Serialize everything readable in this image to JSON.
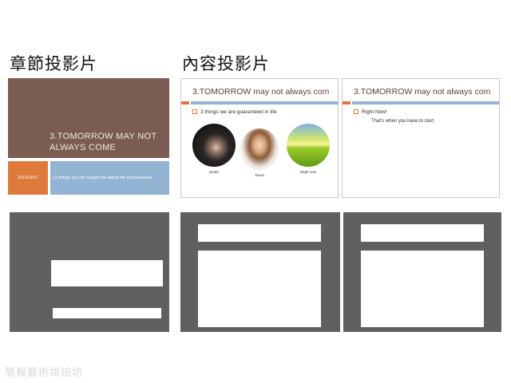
{
  "labels": {
    "section_slide": "章節投影片",
    "content_slide": "內容投影片"
  },
  "section_slide": {
    "title": "3.TOMORROW MAY NOT ALWAYS COME",
    "date": "2013/10/17",
    "subtitle": "11 things my son taught me about life and business",
    "colors": {
      "title_bg": "#7a5c52",
      "date_bg": "#df7a3d",
      "subtitle_bg": "#93b4d2"
    }
  },
  "content_slide_1": {
    "title_upper": "3.TOMORROW",
    "title_rest": " may not always com",
    "bullet": "3 things we are guaranteed in life",
    "pictures": [
      {
        "caption": "Death",
        "icon": "grieving-person-photo"
      },
      {
        "caption": "Taxes",
        "icon": "stressed-woman-photo"
      },
      {
        "caption": "Right now",
        "icon": "sunrise-field-photo"
      }
    ]
  },
  "content_slide_2": {
    "title_upper": "3.TOMORROW",
    "title_rest": " may not always com",
    "bullet": "Right Now!",
    "sub_bullet": "That's when you have to start"
  },
  "watermark": "簡報藝術烘焙坊"
}
